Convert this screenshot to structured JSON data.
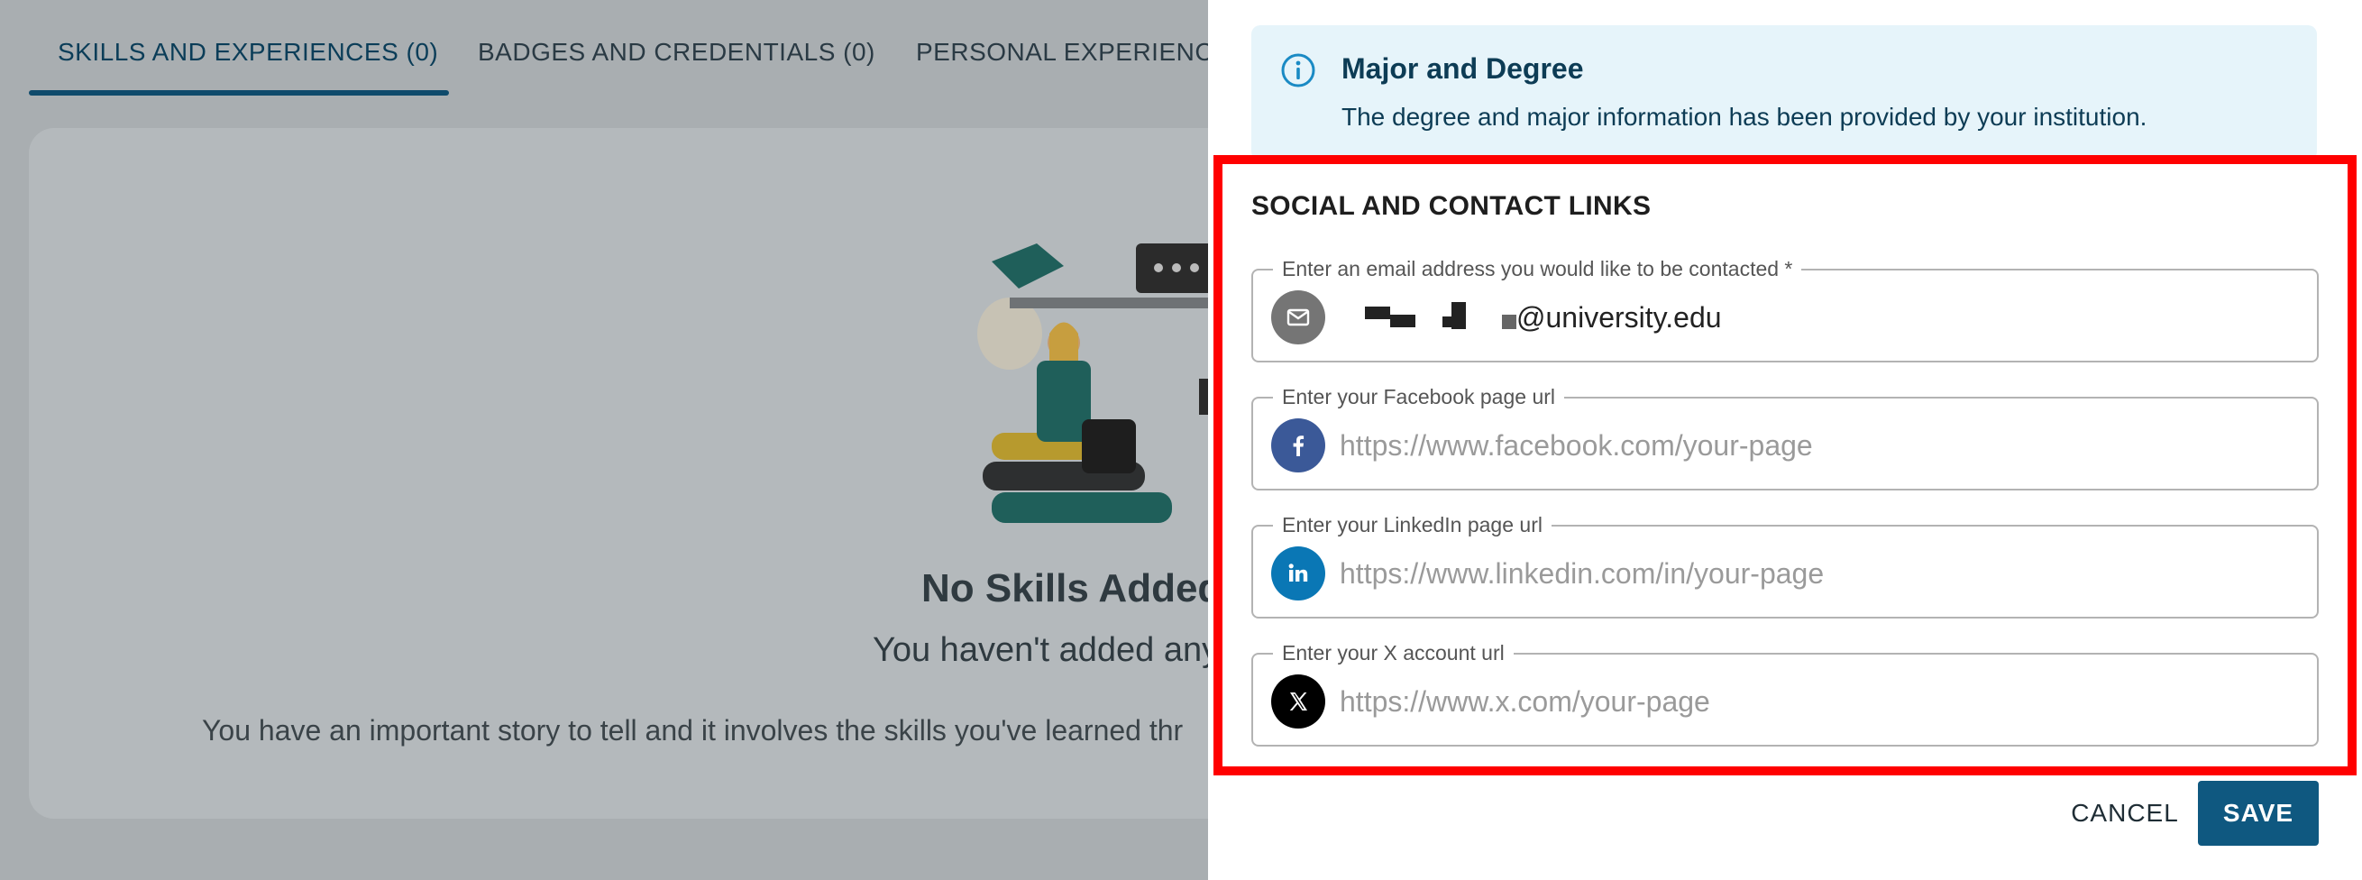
{
  "background": {
    "tabs": [
      {
        "label": "SKILLS AND EXPERIENCES (0)",
        "active": true
      },
      {
        "label": "BADGES AND CREDENTIALS (0)",
        "active": false
      },
      {
        "label": "PERSONAL EXPERIENCE",
        "active": false
      }
    ],
    "empty_state": {
      "title": "No Skills Added",
      "subtitle": "You haven't added any",
      "body": "You have an important story to tell and it involves the skills you've learned thr"
    }
  },
  "drawer": {
    "info": {
      "icon": "info-icon",
      "title": "Major and Degree",
      "text": "The degree and major information has been provided by your institution."
    },
    "section_title": "SOCIAL AND CONTACT LINKS",
    "fields": {
      "email": {
        "label": "Enter an email address you would like to be contacted *",
        "value_suffix": "@university.edu",
        "icon": "mail-icon",
        "icon_color": "#757575"
      },
      "facebook": {
        "label": "Enter your Facebook page url",
        "placeholder": "https://www.facebook.com/your-page",
        "icon": "facebook-icon",
        "icon_color": "#3b5998"
      },
      "linkedin": {
        "label": "Enter your LinkedIn page url",
        "placeholder": "https://www.linkedin.com/in/your-page",
        "icon": "linkedin-icon",
        "icon_color": "#0a77b5"
      },
      "x": {
        "label": "Enter your X account url",
        "placeholder": "https://www.x.com/your-page",
        "icon": "x-icon",
        "icon_color": "#000000"
      }
    },
    "buttons": {
      "cancel": "CANCEL",
      "save": "SAVE"
    },
    "colors": {
      "accent": "#0f5880",
      "highlight_border": "#ff0000",
      "info_bg": "#e6f4fa"
    }
  }
}
